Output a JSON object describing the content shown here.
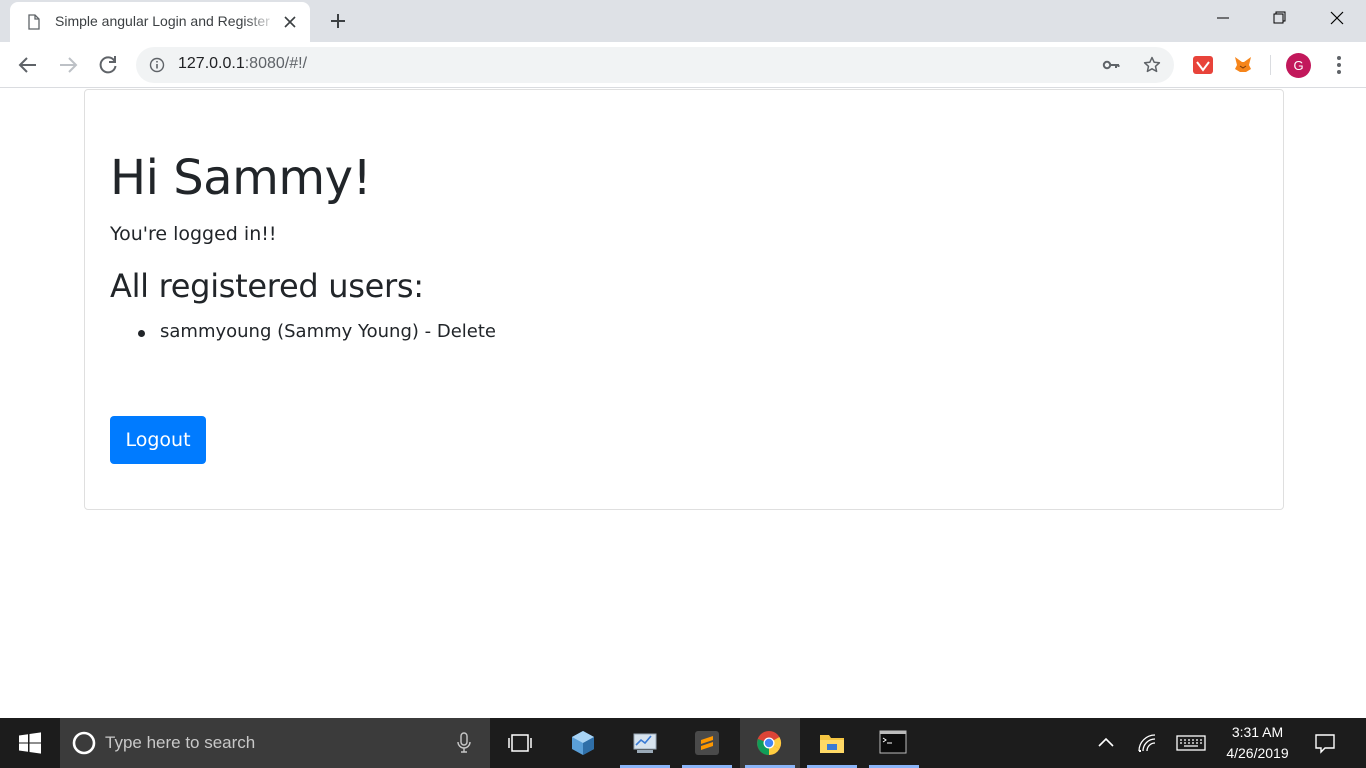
{
  "browser": {
    "tab_title": "Simple angular Login and Register",
    "url_host": "127.0.0.1",
    "url_rest": ":8080/#!/",
    "profile_initial": "G"
  },
  "page": {
    "greeting": "Hi Sammy!",
    "status": "You're logged in!!",
    "users_heading": "All registered users:",
    "users": [
      {
        "text": "sammyoung (Sammy Young) - ",
        "delete_label": "Delete"
      }
    ],
    "logout_label": "Logout",
    "accent_color": "#007bff"
  },
  "taskbar": {
    "search_placeholder": "Type here to search",
    "time": "3:31 AM",
    "date": "4/26/2019"
  }
}
